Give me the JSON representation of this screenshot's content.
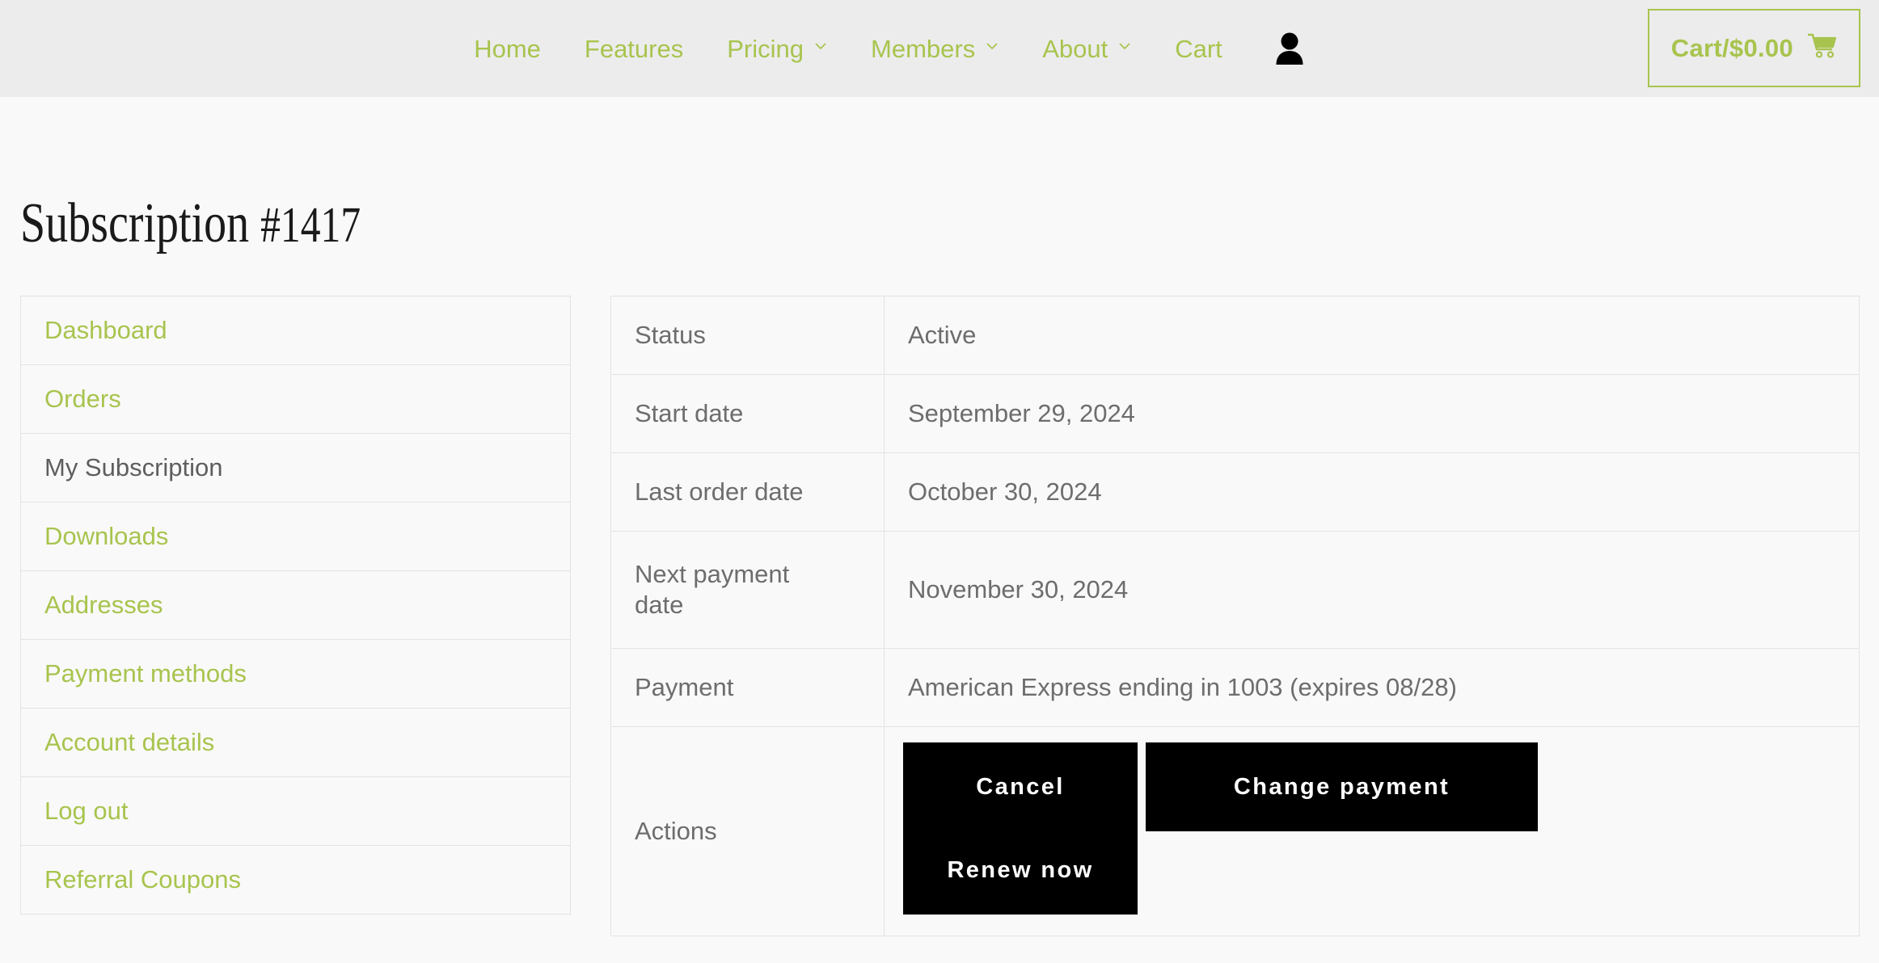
{
  "header": {
    "nav_items": [
      {
        "label": "Home",
        "has_dropdown": false
      },
      {
        "label": "Features",
        "has_dropdown": false
      },
      {
        "label": "Pricing",
        "has_dropdown": true
      },
      {
        "label": "Members",
        "has_dropdown": true
      },
      {
        "label": "About",
        "has_dropdown": true
      },
      {
        "label": "Cart",
        "has_dropdown": false
      }
    ],
    "account_icon": "user-icon",
    "cart": {
      "label": "Cart/$0.00",
      "icon": "shopping-cart-icon"
    },
    "background_color": "#ececec",
    "accent_color": "#a8c44e"
  },
  "page": {
    "title_text": "Subscription ",
    "title_number": "#1417",
    "background_color": "#f9f9f9"
  },
  "sidebar": {
    "items": [
      {
        "label": "Dashboard",
        "active": false
      },
      {
        "label": "Orders",
        "active": false
      },
      {
        "label": "My Subscription",
        "active": true
      },
      {
        "label": "Downloads",
        "active": false
      },
      {
        "label": "Addresses",
        "active": false
      },
      {
        "label": "Payment methods",
        "active": false
      },
      {
        "label": "Account details",
        "active": false
      },
      {
        "label": "Log out",
        "active": false
      },
      {
        "label": "Referral Coupons",
        "active": false
      }
    ]
  },
  "details": {
    "rows": [
      {
        "label": "Status",
        "value": "Active"
      },
      {
        "label": "Start date",
        "value": "September 29, 2024"
      },
      {
        "label": "Last order date",
        "value": "October 30, 2024"
      },
      {
        "label": "Next payment date",
        "value": "November 30, 2024"
      },
      {
        "label": "Payment",
        "value": "American Express ending in 1003 (expires 08/28)"
      },
      {
        "label": "Actions",
        "value": ""
      }
    ],
    "actions": {
      "cancel_label": "Cancel",
      "change_payment_label": "Change payment",
      "renew_now_label": "Renew now",
      "button_color": "#000000",
      "button_text_color": "#ffffff"
    }
  }
}
